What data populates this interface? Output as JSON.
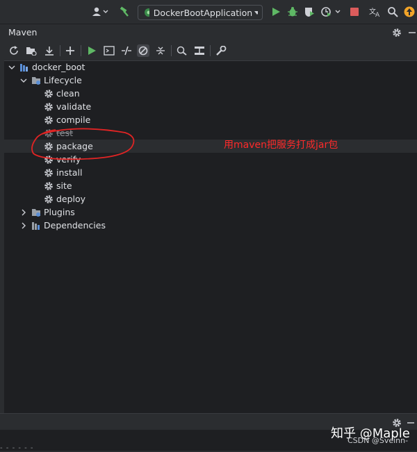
{
  "topbar": {
    "run_config": "DockerBootApplication"
  },
  "panel": {
    "title": "Maven"
  },
  "tree": {
    "root": "docker_boot",
    "lifecycle": "Lifecycle",
    "phases": [
      "clean",
      "validate",
      "compile",
      "test",
      "package",
      "verify",
      "install",
      "site",
      "deploy"
    ],
    "plugins": "Plugins",
    "dependencies": "Dependencies"
  },
  "annotation": {
    "text": "用maven把服务打成jar包"
  },
  "watermark": {
    "line1": "知乎 @Maple",
    "line2": "CSDN @Sveinn-"
  },
  "colors": {
    "accent_green": "#5fb865",
    "annotation_red": "#ff2a2a",
    "stop_red": "#db5c5c",
    "update_orange": "#f2a428"
  },
  "icons": [
    "user-icon",
    "build-hammer-icon",
    "run-icon",
    "debug-icon",
    "coverage-icon",
    "profile-icon",
    "stop-icon",
    "translate-icon",
    "search-icon",
    "update-icon",
    "settings-gear-icon"
  ]
}
